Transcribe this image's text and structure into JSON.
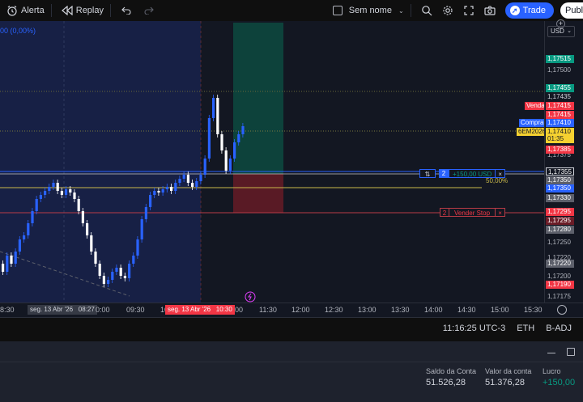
{
  "toolbar": {
    "alert_label": "Alerta",
    "replay_label": "Replay",
    "chart_name": "Sem nome",
    "trade_label": "Trade",
    "publish_label": "Publi"
  },
  "chart": {
    "change_readout": "00 (0,00%)",
    "currency": "USD"
  },
  "price_tags": {
    "p17515": "1,17515",
    "p17500": "1,17500",
    "p17455": "1,17455",
    "p17435": "1,17435",
    "p17415a": "1,17415",
    "p17415b": "1,17415",
    "p17410": "1,17410",
    "p17410b": "1,17410",
    "countdown": "01:35",
    "p17375": "1,17375",
    "p17385": "1,17385",
    "p17355": "1,17355",
    "p17350a": "1,17350",
    "p17350b": "1,17350",
    "p17330": "1,17330",
    "p17295a": "1,17295",
    "p17295b": "1,17295",
    "p17280": "1,17280",
    "p17250": "1,17250",
    "p17220a": "1,17220",
    "p17220b": "1,17220",
    "p17200": "1,17200",
    "p17190": "1,17190",
    "p17175": "1,17175",
    "venda_label": "Venda",
    "compra_label": "Compra",
    "symbol_label": "6EM2026"
  },
  "orders": {
    "position_qty": "2",
    "position_pnl": "+150,00 USD",
    "position_close": "×",
    "fib_label": "50,00%",
    "stop_qty": "2",
    "stop_label": "Vender Stop",
    "stop_close": "×"
  },
  "time_axis": {
    "t0": "8:30",
    "t1": "seg. 13 Abr '26",
    "t1b": "08:27",
    "t2": "0:00",
    "t3": "09:30",
    "t4": "10",
    "t5": "seg. 13 Abr '26",
    "t5b": "10:30",
    "t6": "00",
    "t7": "11:30",
    "t8": "12:00",
    "t9": "12:30",
    "t10": "13:00",
    "t11": "13:30",
    "t12": "14:00",
    "t13": "14:30",
    "t14": "15:00",
    "t15": "15:30"
  },
  "status": {
    "clock": "11:16:25 UTC-3",
    "session": "ETH",
    "adjust": "B-ADJ"
  },
  "account": {
    "balance_label": "Saldo da Conta",
    "balance_value": "51.526,28",
    "equity_label": "Valor da conta",
    "equity_value": "51.376,28",
    "profit_label": "Lucro",
    "profit_value": "+150,00"
  },
  "colors": {
    "up": "#2962ff",
    "down": "#ffffff",
    "sell_red": "#f23645",
    "buy_blue": "#2962ff",
    "profit_green": "#089981"
  }
}
